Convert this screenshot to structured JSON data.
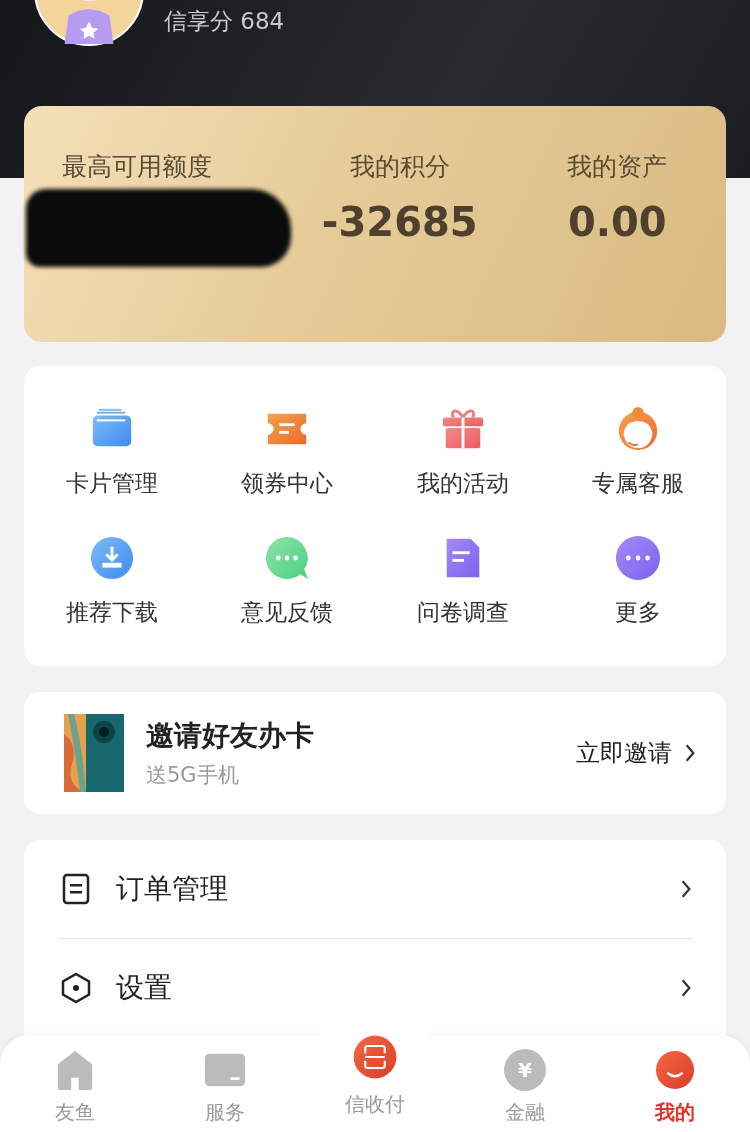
{
  "profile": {
    "score_label": "信享分 684"
  },
  "summary": {
    "stats": [
      {
        "label": "最高可用额度",
        "kind": "redacted"
      },
      {
        "label": "我的积分",
        "value": "-32685",
        "kind": "value"
      },
      {
        "label": "我的资产",
        "value": "0.00",
        "kind": "value"
      }
    ]
  },
  "shortcuts": [
    {
      "label": "卡片管理",
      "kind": "cards"
    },
    {
      "label": "领券中心",
      "kind": "coupon"
    },
    {
      "label": "我的活动",
      "kind": "gift"
    },
    {
      "label": "专属客服",
      "kind": "agent"
    },
    {
      "label": "推荐下载",
      "kind": "download"
    },
    {
      "label": "意见反馈",
      "kind": "chat"
    },
    {
      "label": "问卷调查",
      "kind": "document"
    },
    {
      "label": "更多",
      "kind": "more"
    }
  ],
  "promo": {
    "title": "邀请好友办卡",
    "subtitle": "送5G手机",
    "action": "立即邀请"
  },
  "menu": [
    {
      "label": "订单管理",
      "kind": "order"
    },
    {
      "label": "设置",
      "kind": "settings"
    }
  ],
  "tab_bar": [
    {
      "label": "友鱼",
      "kind": "home",
      "selected": false
    },
    {
      "label": "服务",
      "kind": "service",
      "selected": false
    },
    {
      "label": "信收付",
      "kind": "scan",
      "selected": false
    },
    {
      "label": "金融",
      "kind": "finance",
      "glyph": "¥",
      "selected": false
    },
    {
      "label": "我的",
      "kind": "me",
      "selected": true
    }
  ]
}
